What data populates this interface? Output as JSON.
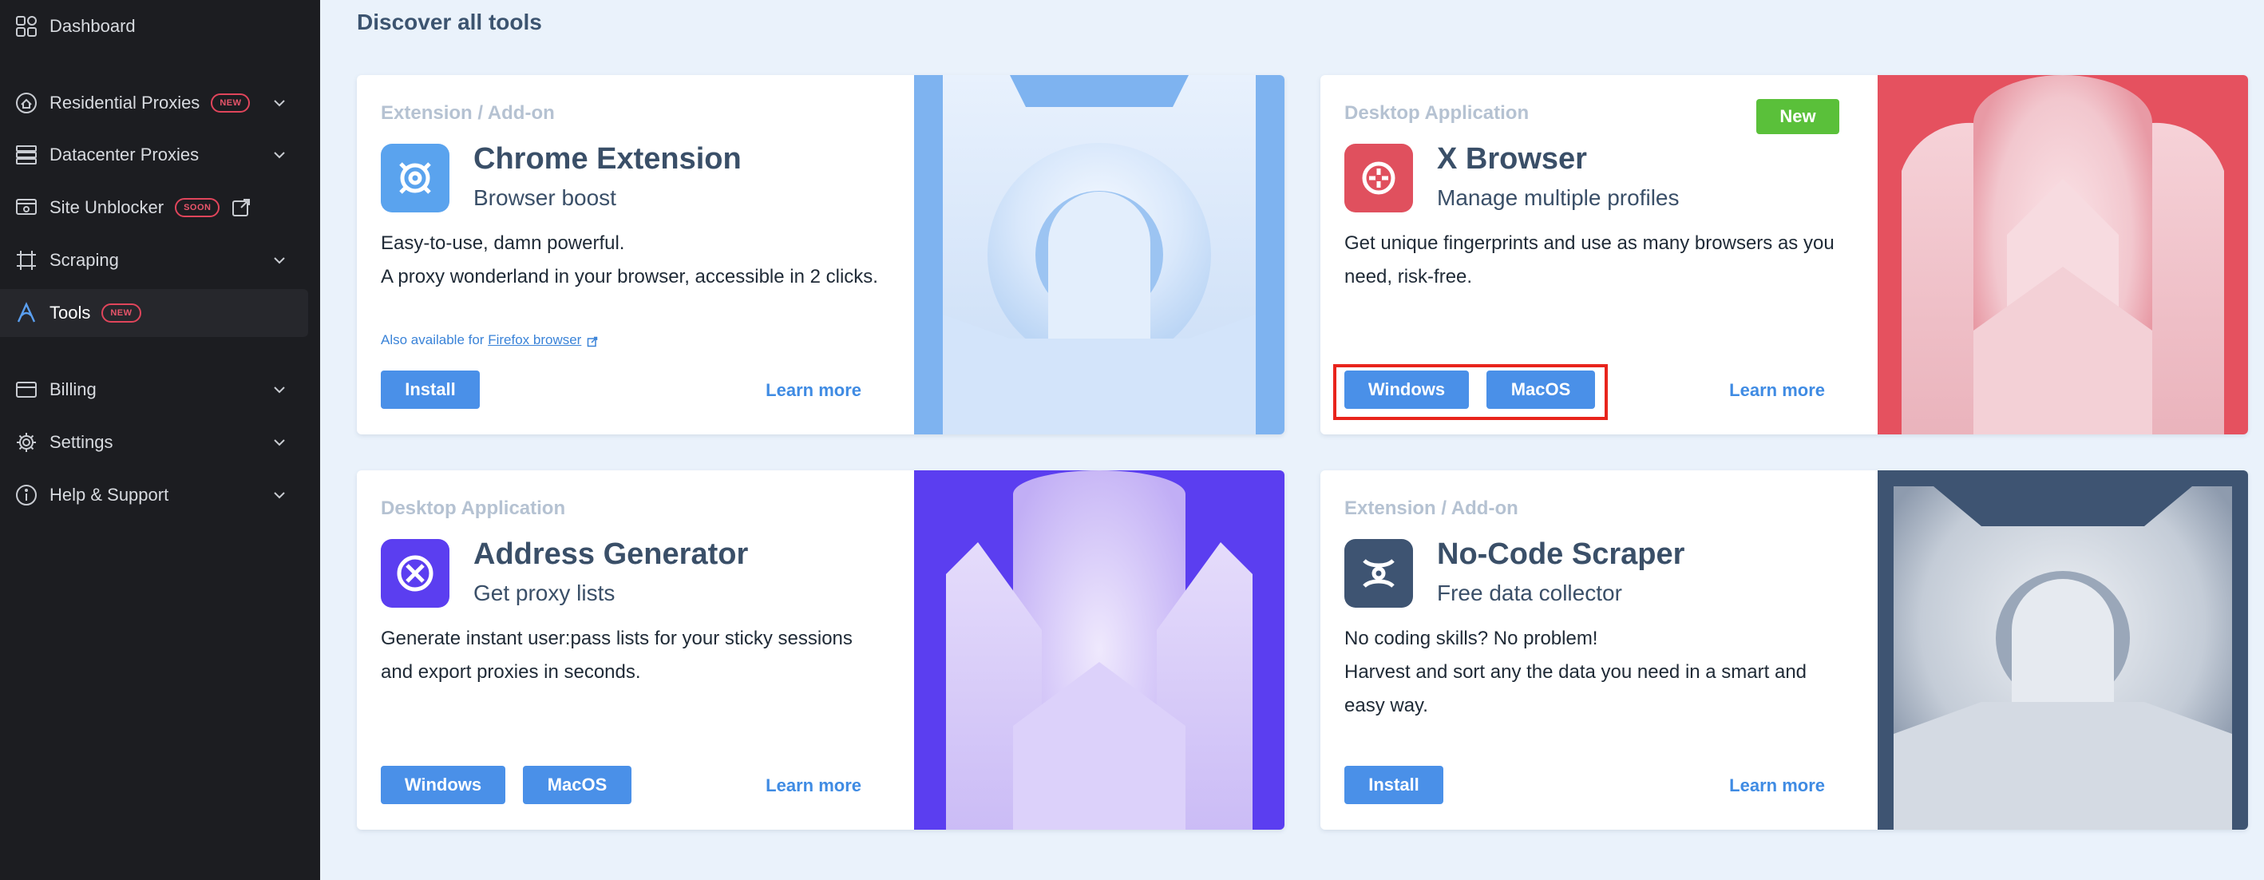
{
  "sidebar": {
    "items": [
      {
        "label": "Dashboard",
        "icon": "dashboard-icon"
      },
      {
        "label": "Residential Proxies",
        "badge": "NEW",
        "icon": "residential-icon"
      },
      {
        "label": "Datacenter Proxies",
        "icon": "datacenter-icon"
      },
      {
        "label": "Site Unblocker",
        "badge": "SOON",
        "icon": "unblocker-icon"
      },
      {
        "label": "Scraping",
        "icon": "scraping-icon"
      },
      {
        "label": "Tools",
        "badge": "NEW",
        "icon": "tools-icon",
        "active": true
      },
      {
        "label": "Billing",
        "icon": "billing-icon"
      },
      {
        "label": "Settings",
        "icon": "gear-icon"
      },
      {
        "label": "Help & Support",
        "icon": "help-icon"
      }
    ]
  },
  "main": {
    "title": "Discover all tools",
    "cards": [
      {
        "category": "Extension / Add-on",
        "title": "Chrome Extension",
        "subtitle": "Browser boost",
        "desc": [
          "Easy-to-use, damn powerful.",
          "A proxy wonderland in your browser, accessible in 2 clicks."
        ],
        "also_prefix": "Also available for",
        "also_link": "Firefox browser",
        "buttons": [
          "Install"
        ],
        "learn_more": "Learn more",
        "accent": "#5aa3ee"
      },
      {
        "category": "Desktop Application",
        "badge": "New",
        "title": "X Browser",
        "subtitle": "Manage multiple profiles",
        "desc": [
          "Get unique fingerprints and use as many browsers as you need, risk-free."
        ],
        "buttons": [
          "Windows",
          "MacOS"
        ],
        "learn_more": "Learn more",
        "accent": "#e0505e"
      },
      {
        "category": "Desktop Application",
        "title": "Address Generator",
        "subtitle": "Get proxy lists",
        "desc": [
          "Generate instant user:pass lists for your sticky sessions and export proxies in seconds."
        ],
        "buttons": [
          "Windows",
          "MacOS"
        ],
        "learn_more": "Learn more",
        "accent": "#5b3ef0"
      },
      {
        "category": "Extension / Add-on",
        "title": "No-Code Scraper",
        "subtitle": "Free data collector",
        "desc": [
          "No coding skills? No problem!",
          "Harvest and sort any the data you need in a smart and easy way."
        ],
        "buttons": [
          "Install"
        ],
        "learn_more": "Learn more",
        "accent": "#3e5472"
      }
    ]
  }
}
